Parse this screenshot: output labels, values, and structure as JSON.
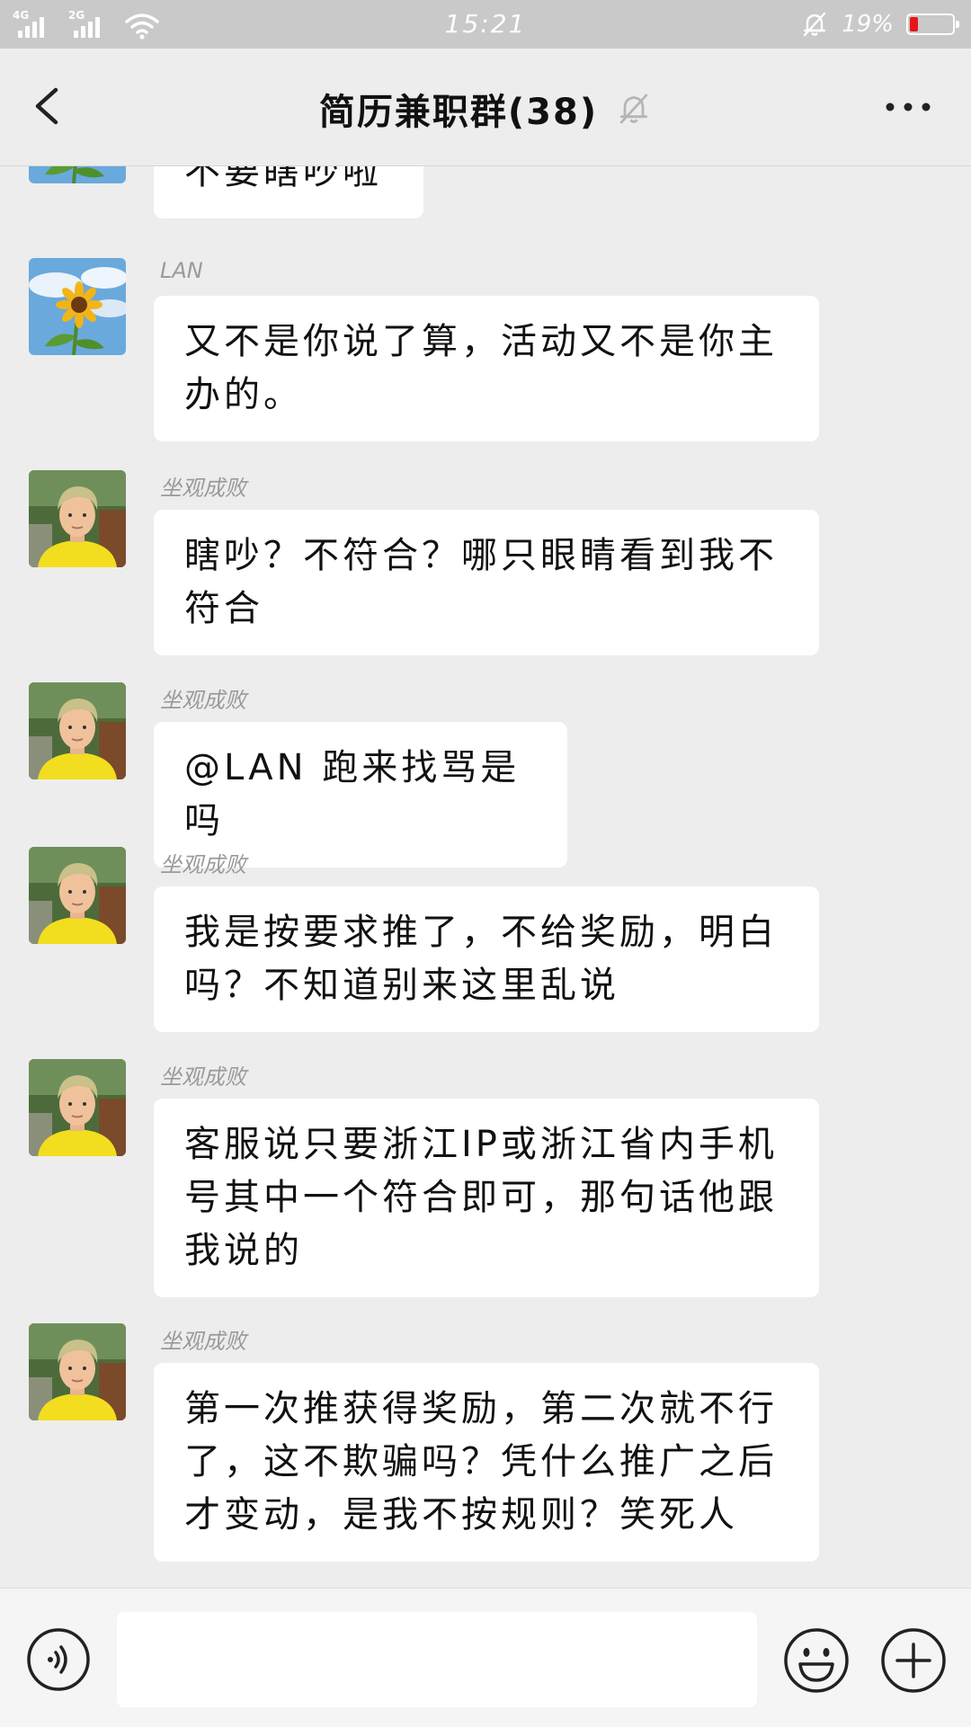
{
  "status_bar": {
    "signal_1_label": "4G",
    "signal_2_label": "2G",
    "time": "15:21",
    "battery_percent": "19%",
    "battery_level": 0.19,
    "battery_color": "#e8141a",
    "icons": [
      "signal-4g-icon",
      "signal-2g-icon",
      "wifi-icon",
      "bell-muted-icon",
      "battery-icon"
    ]
  },
  "header": {
    "title": "简历兼职群(38)",
    "back_icon": "chevron-left-icon",
    "mute_icon": "bell-muted-icon",
    "more_icon": "more-dots-icon"
  },
  "messages": [
    {
      "sender": "",
      "avatar": "sunflower",
      "text": "不要瞎吵啦"
    },
    {
      "sender": "LAN",
      "avatar": "sunflower",
      "text": "又不是你说了算，活动又不是你主办的。"
    },
    {
      "sender": "坐观成败",
      "avatar": "person-yellow-shirt",
      "text": "瞎吵？不符合？哪只眼睛看到我不符合"
    },
    {
      "sender": "坐观成败",
      "avatar": "person-yellow-shirt",
      "text": "@LAN 跑来找骂是吗"
    },
    {
      "sender": "坐观成败",
      "avatar": "person-yellow-shirt",
      "text": "我是按要求推了，不给奖励，明白吗？不知道别来这里乱说"
    },
    {
      "sender": "坐观成败",
      "avatar": "person-yellow-shirt",
      "text": "客服说只要浙江IP或浙江省内手机号其中一个符合即可，那句话他跟我说的"
    },
    {
      "sender": "坐观成败",
      "avatar": "person-yellow-shirt",
      "text": "第一次推获得奖励，第二次就不行了，这不欺骗吗？凭什么推广之后才变动，是我不按规则？笑死人"
    }
  ],
  "input_bar": {
    "placeholder": "",
    "voice_icon": "voice-icon",
    "emoji_icon": "emoji-icon",
    "plus_icon": "plus-icon"
  },
  "colors": {
    "background": "#ededed",
    "bubble": "#ffffff",
    "status_bar": "#c9c9c9",
    "sender_name": "#9a9a9a"
  }
}
